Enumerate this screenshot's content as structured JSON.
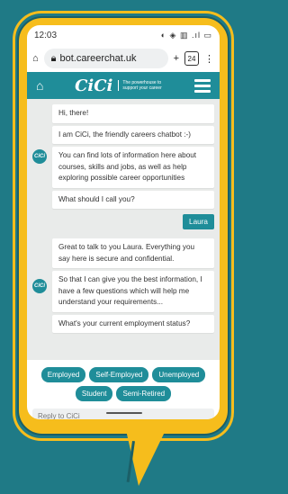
{
  "status": {
    "time": "12:03",
    "icons": "◐ ◈ ▥ .ıl ▭"
  },
  "browser": {
    "url": "bot.careerchat.uk",
    "tab_count": "24"
  },
  "app": {
    "logo_text": "CiCi",
    "tagline": "The powerhouse to support your career",
    "avatar_text": "CiCi"
  },
  "chat": {
    "group1": [
      "Hi, there!",
      "I am CiCi, the friendly careers chatbot :-)",
      "You can find lots of information here about courses, skills and jobs, as well as help exploring possible career opportunities",
      "What should I call you?"
    ],
    "user_reply": "Laura",
    "group2": [
      "Great to talk to you Laura. Everything you say here is secure and confidential.",
      "So that I can give you the best information, I have a few questions which will help me understand your requirements...",
      "What's your current employment status?"
    ]
  },
  "options": [
    "Employed",
    "Self-Employed",
    "Unemployed",
    "Student",
    "Semi-Retired"
  ],
  "reply_placeholder": "Reply to CiCi",
  "colors": {
    "teal": "#1f8d99",
    "yellow": "#f6bd1c",
    "background": "#1f7a86"
  }
}
